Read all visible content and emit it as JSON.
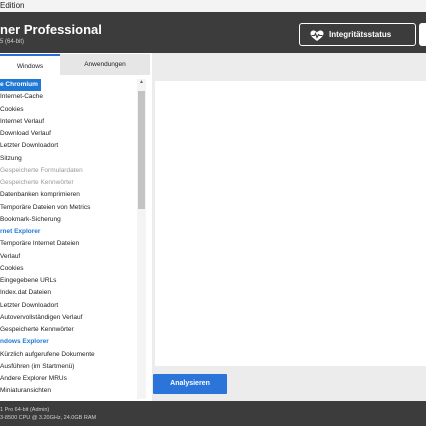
{
  "window": {
    "title_fragment": "Edition"
  },
  "header": {
    "title": "ner Professional",
    "subtitle": "5 (64-bit)",
    "integrity_button": {
      "label": "Integritätsstatus",
      "icon": "heart-pulse-icon"
    }
  },
  "tabs": [
    {
      "label": "Windows",
      "active": true
    },
    {
      "label": "Anwendungen",
      "active": false
    }
  ],
  "list": [
    {
      "label": "e Chromium",
      "type": "selected"
    },
    {
      "label": "Internet-Cache",
      "type": "item"
    },
    {
      "label": "Cookies",
      "type": "item"
    },
    {
      "label": "Internet Verlauf",
      "type": "item"
    },
    {
      "label": "Download Verlauf",
      "type": "item"
    },
    {
      "label": "Letzter Downloadort",
      "type": "item"
    },
    {
      "label": "Sitzung",
      "type": "item"
    },
    {
      "label": "Gespeicherte Formulardaten",
      "type": "disabled"
    },
    {
      "label": "Gespeicherte Kennwörter",
      "type": "disabled"
    },
    {
      "label": "Datenbanken komprimieren",
      "type": "item"
    },
    {
      "label": "Temporäre Dateien von Metrics",
      "type": "item"
    },
    {
      "label": "Bookmark-Sicherung",
      "type": "item"
    },
    {
      "label": "rnet Explorer",
      "type": "header"
    },
    {
      "label": "Temporäre Internet Dateien",
      "type": "item"
    },
    {
      "label": "Verlauf",
      "type": "item"
    },
    {
      "label": "Cookies",
      "type": "item"
    },
    {
      "label": "Eingegebene URLs",
      "type": "item"
    },
    {
      "label": "Index.dat Dateien",
      "type": "item"
    },
    {
      "label": "Letzter Downloadort",
      "type": "item"
    },
    {
      "label": "Autovervollständigen Verlauf",
      "type": "item"
    },
    {
      "label": "Gespeicherte Kennwörter",
      "type": "item"
    },
    {
      "label": "ndows Explorer",
      "type": "header"
    },
    {
      "label": "Kürzlich aufgerufene Dokumente",
      "type": "item"
    },
    {
      "label": "Ausführen (im Startmenü)",
      "type": "item"
    },
    {
      "label": "Andere Explorer MRUs",
      "type": "item"
    },
    {
      "label": "Miniaturansichten",
      "type": "item"
    }
  ],
  "actions": {
    "analyze_label": "Analysieren"
  },
  "footer": {
    "line1": "1 Pro 64-bit (Admin)",
    "line2": "3-8500 CPU @ 3.20GHz, 24.0GB RAM"
  },
  "colors": {
    "accent": "#1f78d6",
    "header_bg": "#3c3c3c",
    "button_blue": "#2b74d9"
  }
}
